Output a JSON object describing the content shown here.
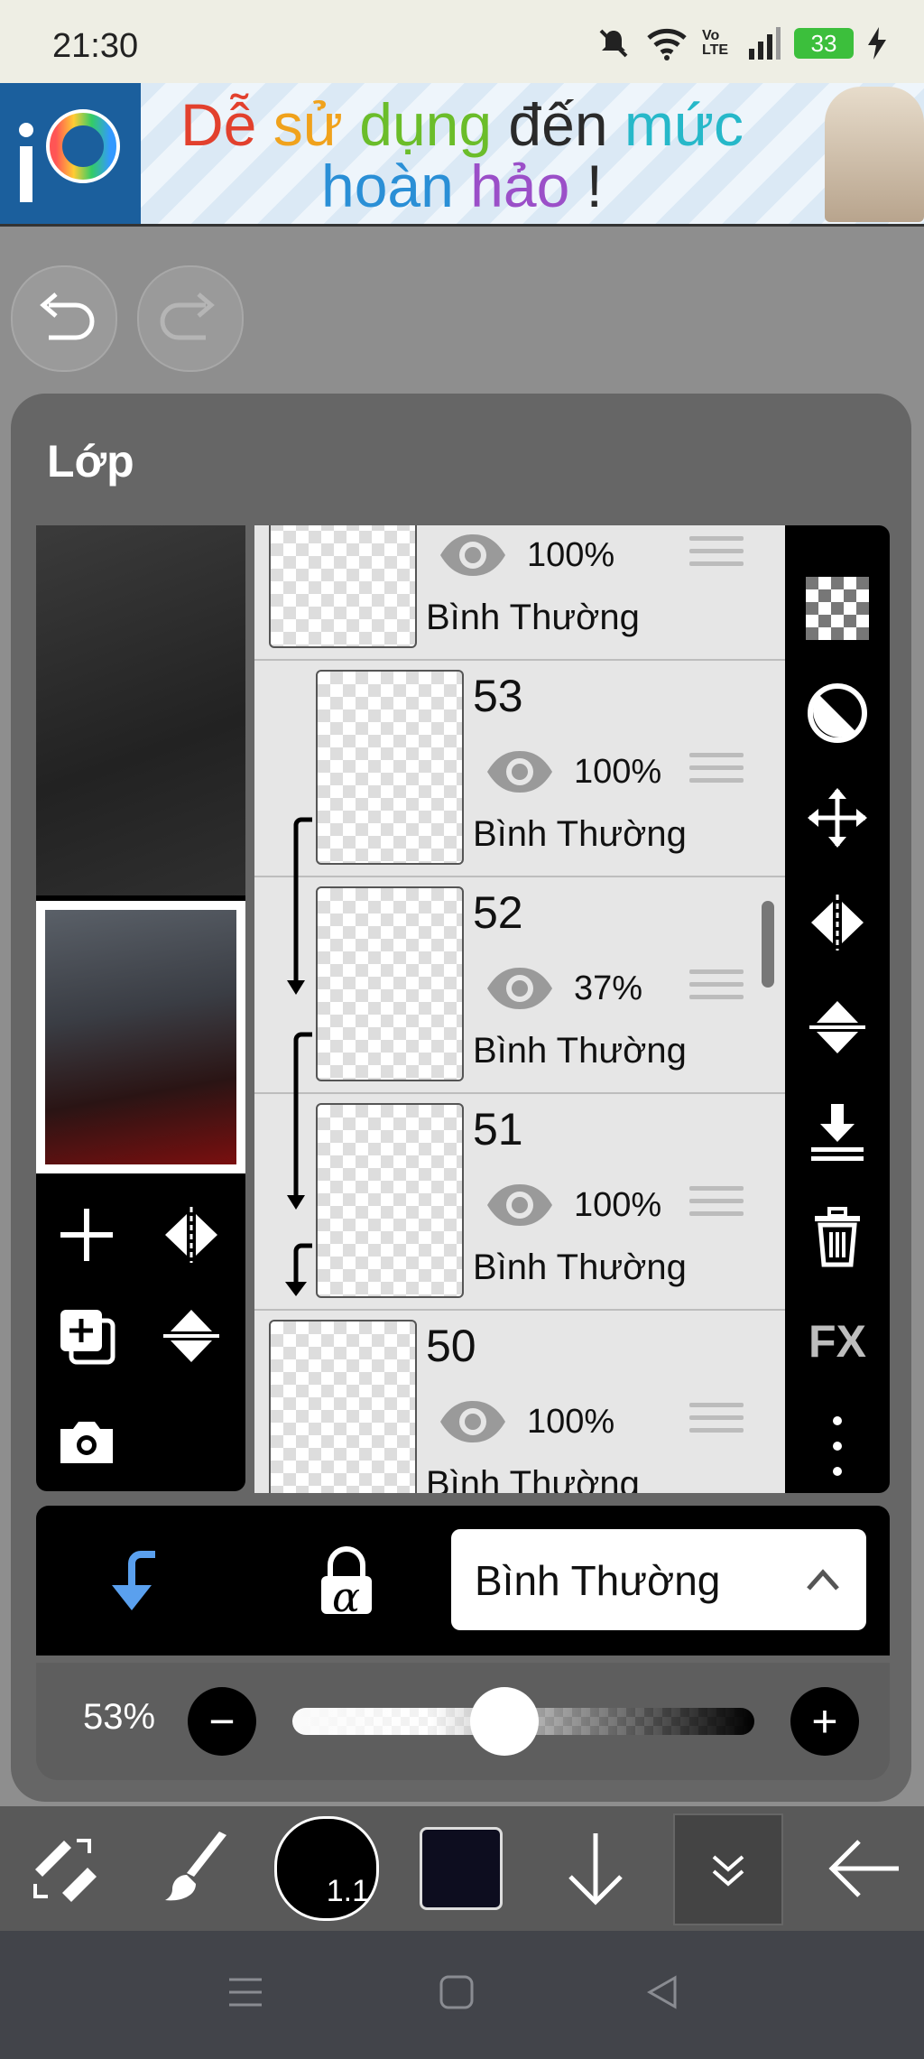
{
  "status_bar": {
    "time": "21:30",
    "battery": "33",
    "network": "Vo LTE"
  },
  "banner": {
    "line1_words": [
      {
        "text": "Dễ ",
        "color": "#e2402d"
      },
      {
        "text": "sử ",
        "color": "#f0a21c"
      },
      {
        "text": "dụng ",
        "color": "#6bbd2a"
      },
      {
        "text": "đến ",
        "color": "#2a2a2a"
      },
      {
        "text": "mức",
        "color": "#26b8c9"
      }
    ],
    "line2_words": [
      {
        "text": "hoàn ",
        "color": "#2a8fd6"
      },
      {
        "text": "hảo",
        "color": "#9b4fc8"
      },
      {
        "text": " !",
        "color": "#2a2a2a"
      }
    ],
    "logo_text": "iP"
  },
  "dialog": {
    "title": "Lớp"
  },
  "layers": [
    {
      "name": "",
      "opacity": "100%",
      "blend": "Bình Thường",
      "clipped": false
    },
    {
      "name": "53",
      "opacity": "100%",
      "blend": "Bình Thường",
      "clipped": true
    },
    {
      "name": "52",
      "opacity": "37%",
      "blend": "Bình Thường",
      "clipped": true
    },
    {
      "name": "51",
      "opacity": "100%",
      "blend": "Bình Thường",
      "clipped": true
    },
    {
      "name": "50",
      "opacity": "100%",
      "blend": "Bình Thường",
      "clipped": false
    }
  ],
  "right_tools": [
    "checker-icon",
    "half-circle-icon",
    "move-icon",
    "flip-horizontal-icon",
    "flip-vertical-icon",
    "merge-down-icon",
    "trash-icon",
    "FX",
    "more-icon"
  ],
  "right_tools_fx_label": "FX",
  "bottom": {
    "blend_mode": "Bình Thường",
    "alpha_lock_label": "α",
    "opacity_label": "53%",
    "opacity_value": 0.53,
    "minus": "−",
    "plus": "+"
  },
  "toolbar": {
    "brush_size": "1.1",
    "color": "#0d0d1f"
  },
  "colors": {
    "accent_blue": "#5aa0ee",
    "panel_black": "#000000",
    "list_bg": "#e6e6e6"
  }
}
